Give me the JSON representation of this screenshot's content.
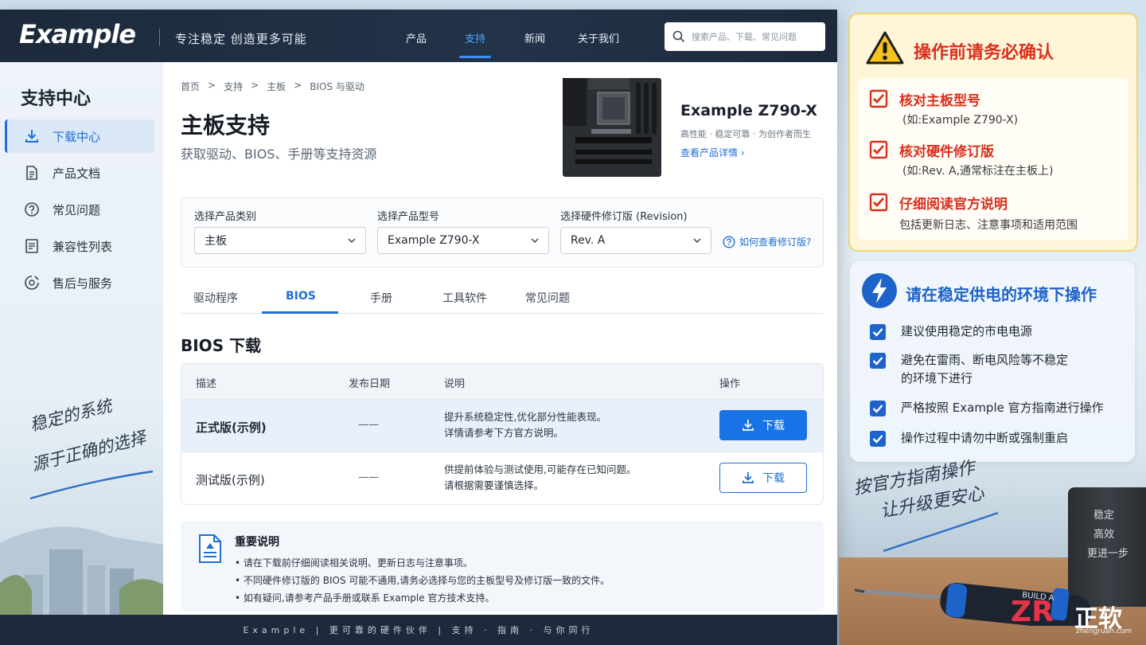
{
  "header": {
    "logo": "Example",
    "slogan": "专注稳定  创造更多可能",
    "nav": [
      "产品",
      "支持",
      "新闻",
      "关于我们"
    ],
    "search_placeholder": "搜索产品、下载、常见问题"
  },
  "sidebar": {
    "title": "支持中心",
    "items": [
      {
        "label": "下载中心",
        "icon": "download-icon"
      },
      {
        "label": "产品文档",
        "icon": "document-icon"
      },
      {
        "label": "常见问题",
        "icon": "help-circle-icon"
      },
      {
        "label": "兼容性列表",
        "icon": "list-icon"
      },
      {
        "label": "售后与服务",
        "icon": "service-icon"
      }
    ],
    "handwriting": [
      "稳定的系统",
      "源于正确的选择"
    ]
  },
  "main": {
    "breadcrumb": [
      "首页",
      ">",
      "支持",
      ">",
      "主板",
      ">",
      "BIOS 与驱动"
    ],
    "title": "主板支持",
    "subtitle": "获取驱动、BIOS、手册等支持资源",
    "product": {
      "name": "Example Z790-X",
      "desc": "高性能 · 稳定可靠 · 为创作者而生",
      "link": "查看产品详情  ›"
    },
    "selectors": [
      {
        "label": "选择产品类别",
        "value": "主板"
      },
      {
        "label": "选择产品型号",
        "value": "Example Z790-X"
      },
      {
        "label": "选择硬件修订版 (Revision)",
        "value": "Rev. A"
      }
    ],
    "help_link": "如何查看修订版?",
    "tabs": [
      "驱动程序",
      "BIOS",
      "手册",
      "工具软件",
      "常见问题"
    ],
    "section_title": "BIOS 下载",
    "table": {
      "headers": [
        "描述",
        "发布日期",
        "说明",
        "操作"
      ],
      "rows": [
        {
          "desc": "正式版(示例)",
          "date": "——",
          "note1": "提升系统稳定性,优化部分性能表现。",
          "note2": "详情请参考下方官方说明。",
          "action": "下载"
        },
        {
          "desc": "测试版(示例)",
          "date": "——",
          "note1": "供提前体验与测试使用,可能存在已知问题。",
          "note2": "请根据需要谨慎选择。",
          "action": "下载"
        }
      ]
    },
    "notice": {
      "title": "重要说明",
      "items": [
        "请在下载前仔细阅读相关说明、更新日志与注意事项。",
        "不同硬件修订版的 BIOS 可能不通用,请务必选择与您的主板型号及修订版一致的文件。",
        "如有疑问,请参考产品手册或联系 Example 官方技术支持。"
      ]
    }
  },
  "footer": {
    "text": "Example  |  更可靠的硬件伙伴  |  支持 · 指南 · 与你同行"
  },
  "warn_card": {
    "title": "操作前请务必确认",
    "items": [
      {
        "h": "核对主板型号",
        "s": "(如:Example Z790-X)"
      },
      {
        "h": "核对硬件修订版",
        "s": "(如:Rev. A,通常标注在主板上)"
      },
      {
        "h": "仔细阅读官方说明",
        "s": "包括更新日志、注意事项和适用范围"
      }
    ]
  },
  "power_card": {
    "title": "请在稳定供电的环境下操作",
    "items": [
      [
        "建议使用稳定的市电电源"
      ],
      [
        "避免在雷雨、断电风险等不稳定",
        "的环境下进行"
      ],
      [
        "严格按照 Example 官方指南进行操作"
      ],
      [
        "操作过程中请勿中断或强制重启"
      ]
    ]
  },
  "right_handwriting": [
    "按官方指南操作",
    "让升级更安心"
  ],
  "mug_text": [
    "稳定",
    "高效",
    "更进一步"
  ],
  "screwdriver_text": "BUILD A",
  "watermark": {
    "logo": "ZR",
    "cn": "正软",
    "url": "zhengruan.com"
  },
  "colors": {
    "accent": "#1874e6",
    "warn": "#d92f1d",
    "nav_bg": "#1c2a3b"
  }
}
